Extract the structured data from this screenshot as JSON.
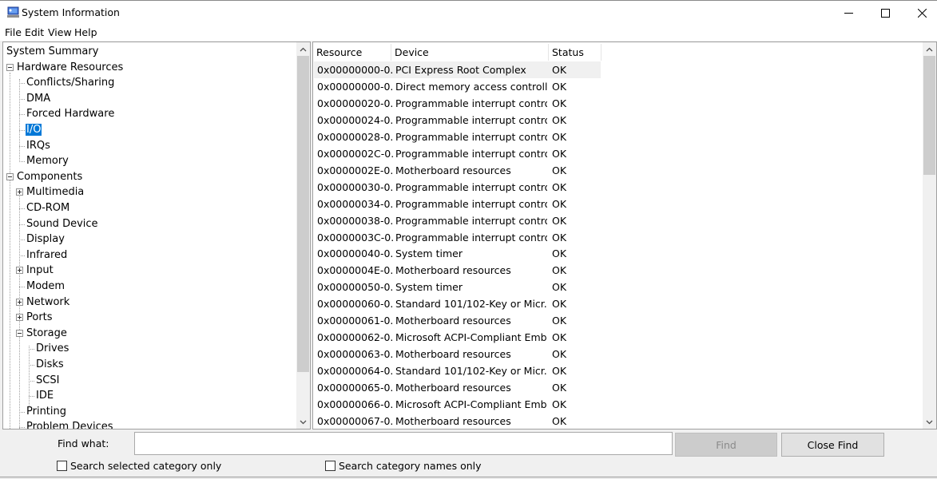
{
  "window": {
    "title": "System Information",
    "controls": {
      "minimize": "—",
      "maximize": "☐",
      "close": "✕"
    }
  },
  "menu": [
    "File",
    "Edit",
    "View",
    "Help"
  ],
  "tree": {
    "items": [
      {
        "label": "System Summary",
        "level": 0,
        "toggle": null
      },
      {
        "label": "Hardware Resources",
        "level": 0,
        "toggle": "minus"
      },
      {
        "label": "Conflicts/Sharing",
        "level": 1,
        "toggle": null
      },
      {
        "label": "DMA",
        "level": 1,
        "toggle": null
      },
      {
        "label": "Forced Hardware",
        "level": 1,
        "toggle": null
      },
      {
        "label": "I/O",
        "level": 1,
        "toggle": null,
        "selected": true
      },
      {
        "label": "IRQs",
        "level": 1,
        "toggle": null
      },
      {
        "label": "Memory",
        "level": 1,
        "toggle": null
      },
      {
        "label": "Components",
        "level": 0,
        "toggle": "minus"
      },
      {
        "label": "Multimedia",
        "level": 1,
        "toggle": "plus"
      },
      {
        "label": "CD-ROM",
        "level": 1,
        "toggle": null
      },
      {
        "label": "Sound Device",
        "level": 1,
        "toggle": null
      },
      {
        "label": "Display",
        "level": 1,
        "toggle": null
      },
      {
        "label": "Infrared",
        "level": 1,
        "toggle": null
      },
      {
        "label": "Input",
        "level": 1,
        "toggle": "plus"
      },
      {
        "label": "Modem",
        "level": 1,
        "toggle": null
      },
      {
        "label": "Network",
        "level": 1,
        "toggle": "plus"
      },
      {
        "label": "Ports",
        "level": 1,
        "toggle": "plus"
      },
      {
        "label": "Storage",
        "level": 1,
        "toggle": "minus"
      },
      {
        "label": "Drives",
        "level": 2,
        "toggle": null
      },
      {
        "label": "Disks",
        "level": 2,
        "toggle": null
      },
      {
        "label": "SCSI",
        "level": 2,
        "toggle": null
      },
      {
        "label": "IDE",
        "level": 2,
        "toggle": null
      },
      {
        "label": "Printing",
        "level": 1,
        "toggle": null
      },
      {
        "label": "Problem Devices",
        "level": 1,
        "toggle": null
      }
    ]
  },
  "table": {
    "columns": [
      "Resource",
      "Device",
      "Status"
    ],
    "rows": [
      [
        "0x00000000-0...",
        "PCI Express Root Complex",
        "OK"
      ],
      [
        "0x00000000-0...",
        "Direct memory access controller",
        "OK"
      ],
      [
        "0x00000020-0...",
        "Programmable interrupt contro...",
        "OK"
      ],
      [
        "0x00000024-0...",
        "Programmable interrupt contro...",
        "OK"
      ],
      [
        "0x00000028-0...",
        "Programmable interrupt contro...",
        "OK"
      ],
      [
        "0x0000002C-0...",
        "Programmable interrupt contro...",
        "OK"
      ],
      [
        "0x0000002E-0...",
        "Motherboard resources",
        "OK"
      ],
      [
        "0x00000030-0...",
        "Programmable interrupt contro...",
        "OK"
      ],
      [
        "0x00000034-0...",
        "Programmable interrupt contro...",
        "OK"
      ],
      [
        "0x00000038-0...",
        "Programmable interrupt contro...",
        "OK"
      ],
      [
        "0x0000003C-0...",
        "Programmable interrupt contro...",
        "OK"
      ],
      [
        "0x00000040-0...",
        "System timer",
        "OK"
      ],
      [
        "0x0000004E-0...",
        "Motherboard resources",
        "OK"
      ],
      [
        "0x00000050-0...",
        "System timer",
        "OK"
      ],
      [
        "0x00000060-0...",
        "Standard 101/102-Key or Micr...",
        "OK"
      ],
      [
        "0x00000061-0...",
        "Motherboard resources",
        "OK"
      ],
      [
        "0x00000062-0...",
        "Microsoft ACPI-Compliant Emb...",
        "OK"
      ],
      [
        "0x00000063-0...",
        "Motherboard resources",
        "OK"
      ],
      [
        "0x00000064-0...",
        "Standard 101/102-Key or Micr...",
        "OK"
      ],
      [
        "0x00000065-0...",
        "Motherboard resources",
        "OK"
      ],
      [
        "0x00000066-0...",
        "Microsoft ACPI-Compliant Emb...",
        "OK"
      ],
      [
        "0x00000067-0...",
        "Motherboard resources",
        "OK"
      ]
    ]
  },
  "find": {
    "label": "Find what:",
    "value": "",
    "placeholder": "",
    "find_button": "Find",
    "close_button": "Close Find",
    "search_selected_label": "Search selected category only",
    "search_selected_checked": false,
    "search_names_label": "Search category names only",
    "search_names_checked": false
  },
  "scroll": {
    "tree_thumb_fraction_start": 0.0,
    "tree_thumb_fraction_size": 0.88,
    "list_thumb_fraction_start": 0.0,
    "list_thumb_fraction_size": 0.33
  },
  "colors": {
    "selection": "#0078d7",
    "accent_icon": "#2b4fb5"
  }
}
